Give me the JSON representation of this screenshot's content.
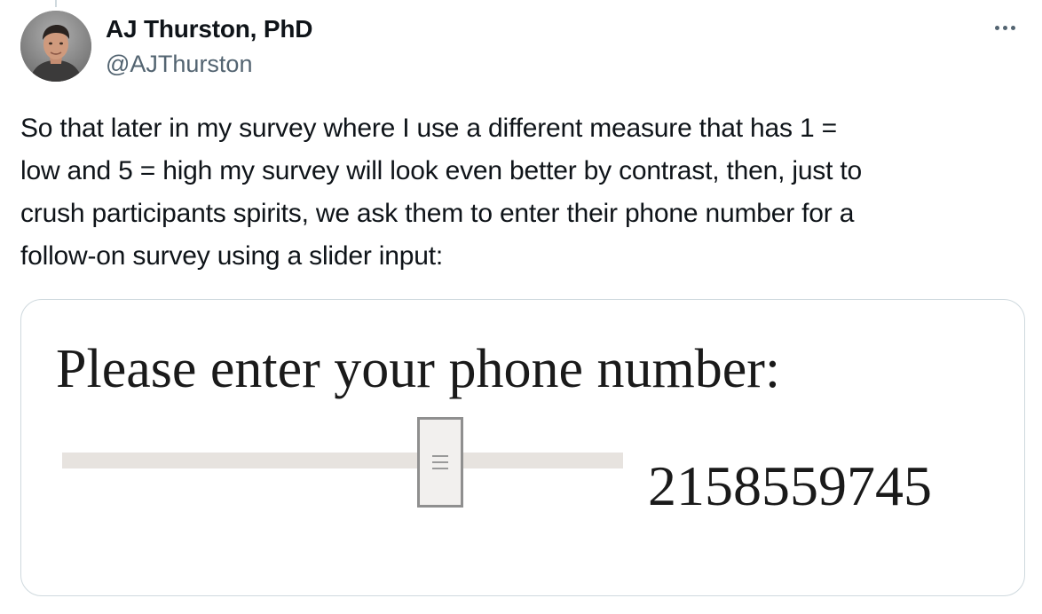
{
  "tweet": {
    "author": {
      "display_name": "AJ Thurston, PhD",
      "handle": "@AJThurston"
    },
    "more_icon": "more-horizontal-icon",
    "text_lines": [
      "So that later in my survey where I use a different measure that has 1 =",
      "low and 5 = high my survey will look even better by contrast, then, just to",
      "crush participants spirits, we ask them to enter their phone number for a",
      "follow-on survey using a slider input:"
    ]
  },
  "media": {
    "prompt": "Please enter your phone number:",
    "slider": {
      "value_text": "2158559745",
      "position_fraction": 0.69
    }
  },
  "colors": {
    "text_primary": "#0f1419",
    "text_secondary": "#536471",
    "border": "#cfd9de"
  }
}
